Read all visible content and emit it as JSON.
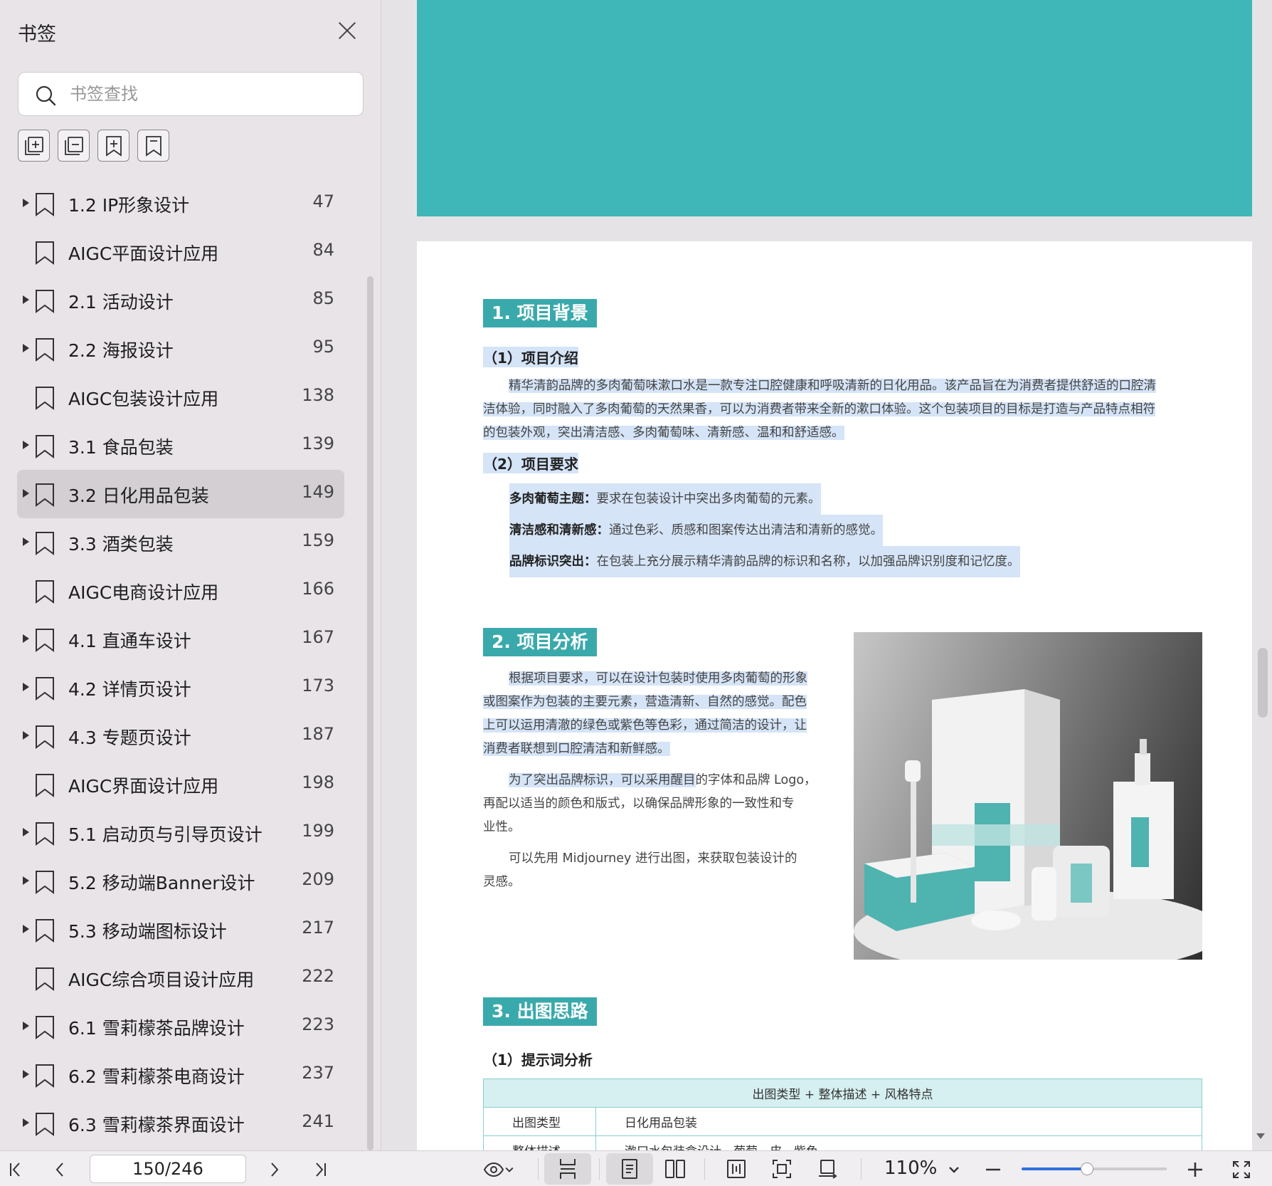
{
  "sidebar": {
    "title": "书签",
    "search_placeholder": "书签查找",
    "tools": [
      "expand-all-icon",
      "collapse-all-icon",
      "add-bookmark-icon",
      "bookmark-icon"
    ],
    "items": [
      {
        "label": "1.2 IP形象设计",
        "page": "47",
        "expandable": true,
        "active": false
      },
      {
        "label": "AIGC平面设计应用",
        "page": "84",
        "expandable": false,
        "active": false
      },
      {
        "label": "2.1 活动设计",
        "page": "85",
        "expandable": true,
        "active": false
      },
      {
        "label": "2.2 海报设计",
        "page": "95",
        "expandable": true,
        "active": false
      },
      {
        "label": "AIGC包装设计应用",
        "page": "138",
        "expandable": false,
        "active": false
      },
      {
        "label": "3.1 食品包装",
        "page": "139",
        "expandable": true,
        "active": false
      },
      {
        "label": "3.2 日化用品包装",
        "page": "149",
        "expandable": true,
        "active": true
      },
      {
        "label": "3.3 酒类包装",
        "page": "159",
        "expandable": true,
        "active": false
      },
      {
        "label": "AIGC电商设计应用",
        "page": "166",
        "expandable": false,
        "active": false
      },
      {
        "label": "4.1 直通车设计",
        "page": "167",
        "expandable": true,
        "active": false
      },
      {
        "label": "4.2 详情页设计",
        "page": "173",
        "expandable": true,
        "active": false
      },
      {
        "label": "4.3 专题页设计",
        "page": "187",
        "expandable": true,
        "active": false
      },
      {
        "label": "AIGC界面设计应用",
        "page": "198",
        "expandable": false,
        "active": false
      },
      {
        "label": "5.1 启动页与引导页设计",
        "page": "199",
        "expandable": true,
        "active": false
      },
      {
        "label": "5.2 移动端Banner设计",
        "page": "209",
        "expandable": true,
        "active": false
      },
      {
        "label": "5.3 移动端图标设计",
        "page": "217",
        "expandable": true,
        "active": false
      },
      {
        "label": "AIGC综合项目设计应用",
        "page": "222",
        "expandable": false,
        "active": false
      },
      {
        "label": "6.1 雪莉檬茶品牌设计",
        "page": "223",
        "expandable": true,
        "active": false
      },
      {
        "label": "6.2 雪莉檬茶电商设计",
        "page": "237",
        "expandable": true,
        "active": false
      },
      {
        "label": "6.3 雪莉檬茶界面设计",
        "page": "241",
        "expandable": true,
        "active": false
      }
    ]
  },
  "doc": {
    "section1_title": "1. 项目背景",
    "sub1_title": "（1）项目介绍",
    "intro_l1": "精华清韵品牌的多肉葡萄味漱口水是一款专注口腔健康和呼吸清新的日化用品。该产品旨在为消费者提供舒适的口腔清",
    "intro_l2": "洁体验，同时融入了多肉葡萄的天然果香，可以为消费者带来全新的漱口体验。这个包装项目的目标是打造与产品特点相符",
    "intro_l3": "的包装外观，突出清洁感、多肉葡萄味、清新感、温和和舒适感。",
    "sub2_title": "（2）项目要求",
    "req1_k": "多肉葡萄主题：",
    "req1_v": "要求在包装设计中突出多肉葡萄的元素。",
    "req2_k": "清洁感和清新感：",
    "req2_v": "通过色彩、质感和图案传达出清洁和清新的感觉。",
    "req3_k": "品牌标识突出：",
    "req3_v": "在包装上充分展示精华清韵品牌的标识和名称，以加强品牌识别度和记忆度。",
    "section2_title": "2. 项目分析",
    "ana_l1": "根据项目要求，可以在设计包装时使用多肉葡萄的形象",
    "ana_l2": "或图案作为包装的主要元素，营造清新、自然的感觉。配色",
    "ana_l3": "上可以运用清澈的绿色或紫色等色彩，通过简洁的设计，让",
    "ana_l4": "消费者联想到口腔清洁和新鲜感。",
    "ana2_hl": "为了突出品牌标识，可以采用醒目",
    "ana2_rest": "的字体和品牌 Logo，",
    "ana2_l2": "再配以适当的颜色和版式，以确保品牌形象的一致性和专",
    "ana2_l3": "业性。",
    "ana3_l1": "可以先用 Midjourney 进行出图，来获取包装设计的",
    "ana3_l2": "灵感。",
    "section3_title": "3. 出图思路",
    "sub3_title": "（1）提示词分析",
    "table_header": "出图类型 + 整体描述 + 风格特点",
    "row1_k": "出图类型",
    "row1_v": "日化用品包装",
    "row2_k": "整体描述",
    "row2_v": "漱口水包装盒设计，葡萄，皮，紫色"
  },
  "statusbar": {
    "page_value": "150/246",
    "zoom": "110%",
    "zoom_fraction": 0.45
  },
  "colors": {
    "accent": "#3aa9ac",
    "highlight": "#d5e4f7",
    "slider": "#2f6fe0"
  }
}
